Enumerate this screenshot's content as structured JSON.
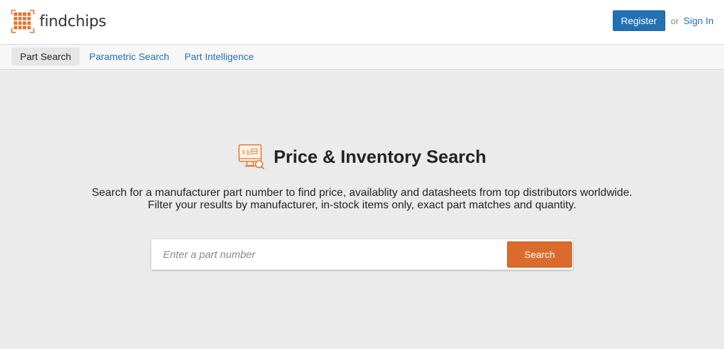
{
  "header": {
    "logo_text": "findchips",
    "register_label": "Register",
    "or_text": "or",
    "signin_label": "Sign In"
  },
  "subnav": {
    "items": [
      {
        "label": "Part Search",
        "active": true
      },
      {
        "label": "Parametric Search",
        "active": false
      },
      {
        "label": "Part Intelligence",
        "active": false
      }
    ]
  },
  "hero": {
    "title": "Price & Inventory Search",
    "icon": "monitor-price-search-icon",
    "description_line1": "Search for a manufacturer part number to find price, availablity and datasheets from top distributors worldwide.",
    "description_line2": "Filter your results by manufacturer, in-stock items only, exact part matches and quantity."
  },
  "search": {
    "placeholder": "Enter a part number",
    "value": "",
    "button_label": "Search"
  },
  "colors": {
    "brand_orange": "#e8742c",
    "search_button": "#db6b2d",
    "register_button": "#2271b3",
    "link": "#2271b3",
    "page_background": "#ebebeb"
  }
}
